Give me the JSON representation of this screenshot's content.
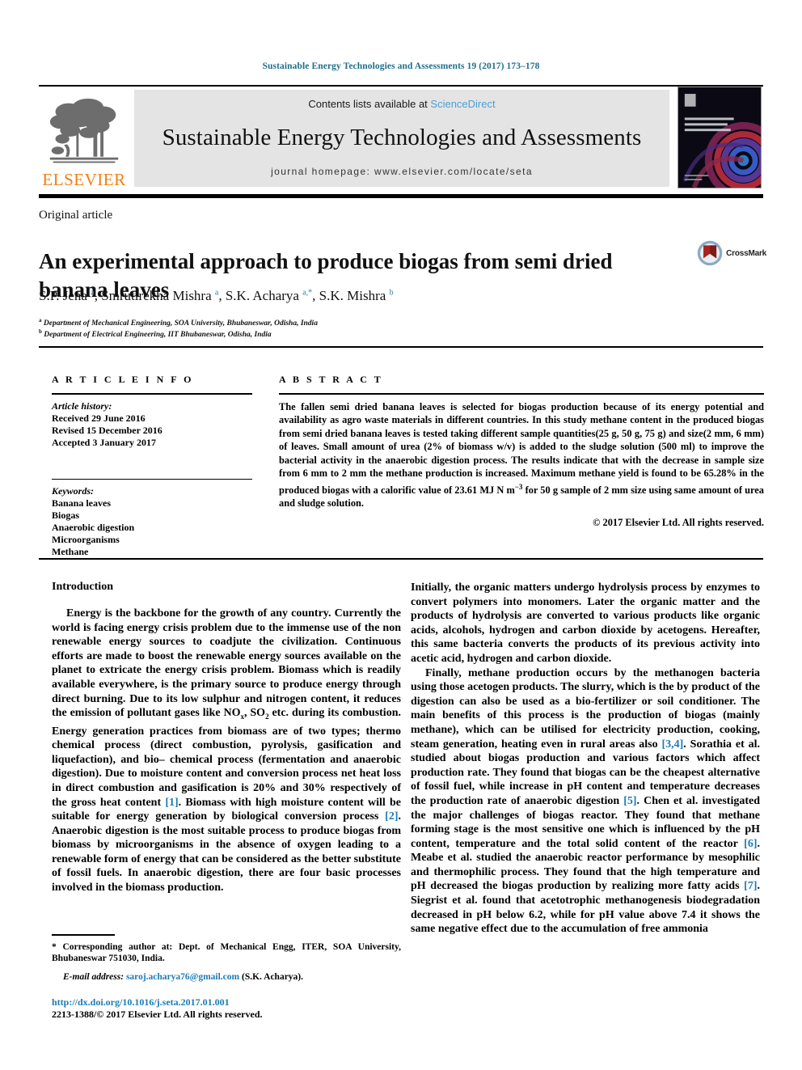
{
  "running_head": "Sustainable Energy Technologies and Assessments 19 (2017) 173–178",
  "masthead": {
    "contents_prefix": "Contents lists available at ",
    "contents_link": "ScienceDirect",
    "journal_title": "Sustainable Energy Technologies and Assessments",
    "homepage": "journal homepage: www.elsevier.com/locate/seta",
    "publisher": "ELSEVIER",
    "cover_title_lines": [
      "SUSTAINABLE ENERGY",
      "TECHNOLOGIES",
      "AND ASSESSMENTS"
    ],
    "colors": {
      "running_head": "#1f6f8b",
      "sciencedirect": "#4a9fd4",
      "elsevier_orange": "#f07f13",
      "panel_grey": "#e4e4e4"
    }
  },
  "article": {
    "type": "Original article",
    "title": "An experimental approach to produce biogas from semi dried banana leaves",
    "crossmark_label": "CrossMark",
    "authors_html": "S.P. Jena <sup>a</sup>, Smrutirekha Mishra <sup>a</sup>, S.K. Acharya <sup>a,*</sup>, S.K. Mishra <sup>b</sup>",
    "affiliation_a": "Department of Mechanical Engineering, SOA University, Bhubaneswar, Odisha, India",
    "affiliation_b": "Department of Electrical Engineering, IIT Bhubaneswar, Odisha, India"
  },
  "article_info": {
    "heading": "A R T I C L E  I N F O",
    "history_label": "Article history:",
    "history": [
      "Received 29 June 2016",
      "Revised 15 December 2016",
      "Accepted 3 January 2017"
    ],
    "keywords_label": "Keywords:",
    "keywords": [
      "Banana leaves",
      "Biogas",
      "Anaerobic digestion",
      "Microorganisms",
      "Methane"
    ]
  },
  "abstract": {
    "heading": "A B S T R A C T",
    "text": "The fallen semi dried banana leaves is selected for biogas production because of its energy potential and availability as agro waste materials in different countries. In this study methane content in the produced biogas from semi dried banana leaves is tested taking different sample quantities(25 g, 50 g, 75 g) and size(2 mm, 6 mm) of leaves. Small amount of urea (2% of biomass w/v) is added to the sludge solution (500 ml) to improve the bacterial activity in the anaerobic digestion process. The results indicate that with the decrease in sample size from 6 mm to 2 mm the methane production is increased. Maximum methane yield is found to be 65.28% in the produced biogas with a calorific value of 23.61 MJ N m",
    "text_sup": "−3",
    "text_tail": " for 50 g sample of 2 mm size using same amount of urea and sludge solution.",
    "copyright": "© 2017 Elsevier Ltd. All rights reserved."
  },
  "body": {
    "left_heading": "Introduction",
    "left_p1": "Energy is the backbone for the growth of any country. Currently the world is facing energy crisis problem due to the immense use of the non renewable energy sources to coadjute the civilization. Continuous efforts are made to boost the renewable energy sources available on the planet to extricate the energy crisis problem. Biomass which is readily available everywhere, is the primary source to produce energy through direct burning. Due to its low sulphur and nitrogen content, it reduces the emission of pollutant gases like NO",
    "left_p1_sub1": "x",
    "left_p1_b": ", SO",
    "left_p1_sub2": "2",
    "left_p1_c": " etc. during its combustion. Energy generation practices from biomass are of two types; thermo chemical process (direct combustion, pyrolysis, gasification and liquefaction), and bio– chemical process (fermentation and anaerobic digestion). Due to moisture content and conversion process net heat loss in direct combustion and gasification is 20% and 30% respectively of the gross heat content ",
    "left_ref1": "[1]",
    "left_p1_d": ". Biomass with high moisture content will be suitable for energy generation by biological conversion process ",
    "left_ref2": "[2]",
    "left_p1_e": ". Anaerobic digestion is the most suitable process to produce biogas from biomass by microorganisms in the absence of oxygen leading to a renewable form of energy that can be considered as the better substitute of fossil fuels. In anaerobic digestion, there are four basic processes involved in the biomass production.",
    "right_p1": "Initially, the organic matters undergo hydrolysis process by enzymes to convert polymers into monomers. Later the organic matter and the products of hydrolysis are converted to various products like organic acids, alcohols, hydrogen and carbon dioxide by acetogens. Hereafter, this same bacteria converts the products of its previous activity into acetic acid, hydrogen and carbon dioxide.",
    "right_p2_a": "Finally, methane production occurs by the methanogen bacteria using those acetogen products. The slurry, which is the by product of the digestion can also be used as a bio-fertilizer or soil conditioner. The main benefits of this process is the production of biogas (mainly methane), which can be utilised for electricity production, cooking, steam generation, heating even in rural areas also ",
    "right_ref34": "[3,4]",
    "right_p2_b": ". Sorathia et al. studied about biogas production and various factors which affect production rate. They found that biogas can be the cheapest alternative of fossil fuel, while increase in pH content and temperature decreases the production rate of anaerobic digestion ",
    "right_ref5": "[5]",
    "right_p2_c": ". Chen et al. investigated the major challenges of biogas reactor. They found that methane forming stage is the most sensitive one which is influenced by the pH content, temperature and the total solid content of the reactor ",
    "right_ref6": "[6]",
    "right_p2_d": ". Meabe et al. studied the anaerobic reactor performance by mesophilic and thermophilic process. They found that the high temperature and pH decreased the biogas production by realizing more fatty acids ",
    "right_ref7": "[7]",
    "right_p2_e": ". Siegrist et al. found that acetotrophic methanogenesis biodegradation decreased in pH below 6.2, while for pH value above 7.4 it shows the same negative effect due to the accumulation of free ammonia"
  },
  "footnote": {
    "corresponding": "* Corresponding author at: Dept. of Mechanical Engg, ITER, SOA University, Bhubaneswar 751030, India.",
    "email_label": "E-mail address:",
    "email": "saroj.acharya76@gmail.com",
    "email_owner": "(S.K. Acharya).",
    "doi": "http://dx.doi.org/10.1016/j.seta.2017.01.001",
    "issn": "2213-1388/© 2017 Elsevier Ltd. All rights reserved."
  }
}
